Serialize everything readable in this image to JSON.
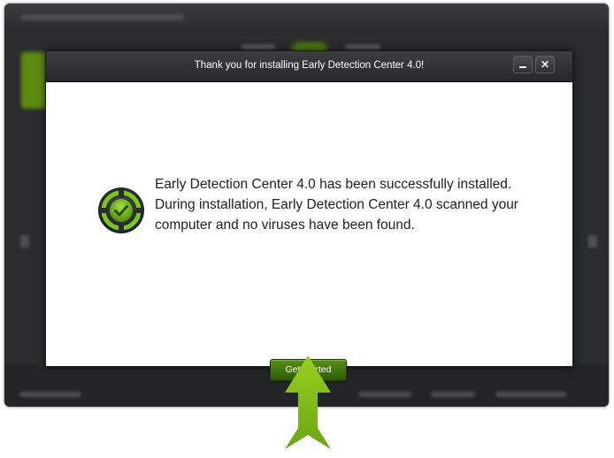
{
  "dialog": {
    "title": "Thank you for installing Early Detection Center 4.0!",
    "message": "Early Detection Center 4.0 has been successfully installed. During installation, Early Detection Center 4.0 scanned your computer and no viruses have been found.",
    "primary_button_label": "Get started",
    "close_label": "✕"
  },
  "icons": {
    "status": "checkmark-shield-icon",
    "pointer": "arrow-up-icon"
  },
  "colors": {
    "accent_green": "#7cc41f",
    "button_green": "#3f7410",
    "arrow_green": "#86c41a",
    "titlebar": "#2e3032"
  }
}
